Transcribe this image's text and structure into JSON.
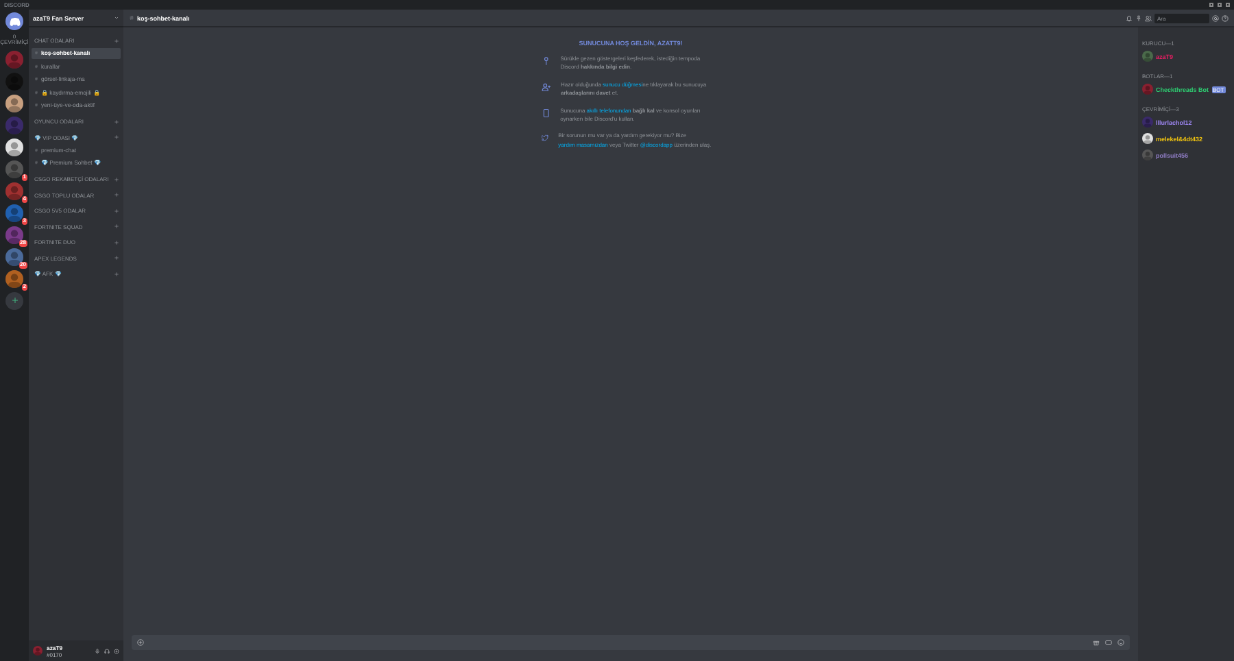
{
  "window": {
    "title": "DISCORD"
  },
  "servers": {
    "online_label": "0 ÇEVRİMİÇİ",
    "items": [
      {
        "kind": "home",
        "selected": false
      },
      {
        "kind": "avatar",
        "selected": false
      },
      {
        "kind": "avatar",
        "selected": false
      },
      {
        "kind": "avatar",
        "selected": false
      },
      {
        "kind": "avatar",
        "selected": false
      },
      {
        "kind": "avatar",
        "selected": false
      },
      {
        "kind": "avatar",
        "badge": "1",
        "selected": false
      },
      {
        "kind": "avatar",
        "badge": "4",
        "selected": false
      },
      {
        "kind": "avatar",
        "badge": "3",
        "selected": false
      },
      {
        "kind": "avatar",
        "badge": "28",
        "selected": false
      },
      {
        "kind": "avatar",
        "badge": "20",
        "selected": false
      },
      {
        "kind": "avatar",
        "badge": "2",
        "selected": false
      },
      {
        "kind": "add",
        "selected": false
      }
    ]
  },
  "server": {
    "name": "azaT9 Fan Server"
  },
  "categories": [
    {
      "name": "CHAT ODALARI",
      "channels": [
        {
          "name": "koş-sohbet-kanalı",
          "selected": true
        },
        {
          "name": "kurallar",
          "selected": false
        },
        {
          "name": "görsel-linkaja-ma",
          "selected": false
        },
        {
          "name": "🔒 kaydırma-emojili 🔒",
          "selected": false
        },
        {
          "name": "yeni-üye-ve-oda-aktif",
          "selected": false
        }
      ]
    },
    {
      "name": "OYUNCU ODALARI"
    },
    {
      "name": "💎 VIP ODASI 💎",
      "channels": [
        {
          "name": "premium-chat",
          "selected": false
        },
        {
          "name": "💎 Premium Sohbet 💎",
          "selected": false
        }
      ]
    },
    {
      "name": "CSGO REKABETÇİ ODALARI"
    },
    {
      "name": "CSGO TOPLU ODALAR"
    },
    {
      "name": "CSGO 5V5 ODALAR"
    },
    {
      "name": "FORTNITE SQUAD"
    },
    {
      "name": "FORTNITE DUO"
    },
    {
      "name": "APEX LEGENDS"
    },
    {
      "name": "💎 AFK 💎"
    }
  ],
  "user": {
    "name": "azaT9",
    "tag": "#0170"
  },
  "header": {
    "channel": "koş-sohbet-kanalı",
    "search_placeholder": "Ara"
  },
  "welcome": {
    "title": "SUNUCUNA HOŞ GELDİN, AZATT9!",
    "items": [
      {
        "kind": "pin",
        "parts": [
          {
            "kind": "text",
            "text": "Sürükle gezen göstergeleri keşfederek, istediğin tempoda Discord **hakkında bilgi edin**."
          }
        ]
      },
      {
        "kind": "invite",
        "parts": [
          {
            "kind": "text",
            "text": "Hazır olduğunda "
          },
          {
            "kind": "link",
            "text": "sunucu düğmesi"
          },
          {
            "kind": "text",
            "text": "ne tıklayarak bu sunucuya **arkadaşlarını davet** et."
          }
        ]
      },
      {
        "kind": "phone",
        "parts": [
          {
            "kind": "text",
            "text": "Sunucuna "
          },
          {
            "kind": "link",
            "text": "akıllı telefonundan"
          },
          {
            "kind": "text",
            "text": " **bağlı kal** ve konsol oyunları oynarken bile Discord'u kullan."
          }
        ]
      },
      {
        "kind": "twitter",
        "parts": [
          {
            "kind": "text",
            "text": "Bir sorunun mu var ya da yardım gerekiyor mu? Bize "
          },
          {
            "kind": "link",
            "text": "yardım masamızdan"
          },
          {
            "kind": "text",
            "text": " veya Twitter "
          },
          {
            "kind": "link",
            "text": "@discordapp"
          },
          {
            "kind": "text",
            "text": " üzerinden ulaş."
          }
        ]
      }
    ]
  },
  "members": [
    {
      "group": "KURUCU—1",
      "items": [
        {
          "name": "azaT9",
          "color": "#e91e63"
        }
      ]
    },
    {
      "group": "BOTLAR—1",
      "items": [
        {
          "name": "Checkthreads Bot",
          "color": "#2ecc71",
          "bot": "BOT"
        }
      ]
    },
    {
      "group": "ÇEVRİMİÇİ—3",
      "items": [
        {
          "name": "lllurlachol12",
          "color": "#9b84ee"
        },
        {
          "name": "melekel&4dt432",
          "color": "#f1c40f"
        },
        {
          "name": "pollsuit456",
          "color": "#8e7cc3"
        }
      ]
    }
  ]
}
